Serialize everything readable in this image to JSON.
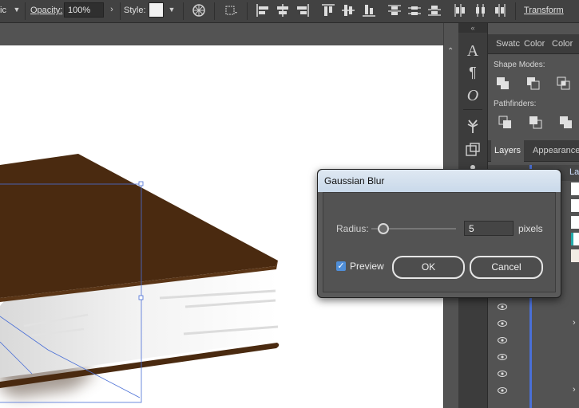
{
  "control_bar": {
    "style_partial": "ic",
    "opacity_label": "Opacity:",
    "opacity_value": "100%",
    "style_label": "Style:",
    "transform_label": "Transform"
  },
  "panel": {
    "tabs": [
      "Swatc",
      "Color",
      "Color"
    ],
    "shape_modes_label": "Shape Modes:",
    "pathfinders_label": "Pathfinders:",
    "layers_tab": "Layers",
    "appearance_tab": "Appearance",
    "layer_name_partial": "La"
  },
  "dialog": {
    "title": "Gaussian Blur",
    "radius_label": "Radius:",
    "radius_value": "5",
    "radius_unit": "pixels",
    "radius_slider_fraction": 0.14,
    "preview_label": "Preview",
    "preview_checked": true,
    "ok_label": "OK",
    "cancel_label": "Cancel"
  },
  "icons": {
    "tools": [
      "type-icon",
      "paragraph-icon",
      "opentype-icon",
      "puppet-warp-icon",
      "artboard-icon"
    ],
    "accent_selection": "#4a6fd6",
    "book_cover_color": "#4a2a10",
    "dialog_title_color": "#d4e1ee"
  }
}
